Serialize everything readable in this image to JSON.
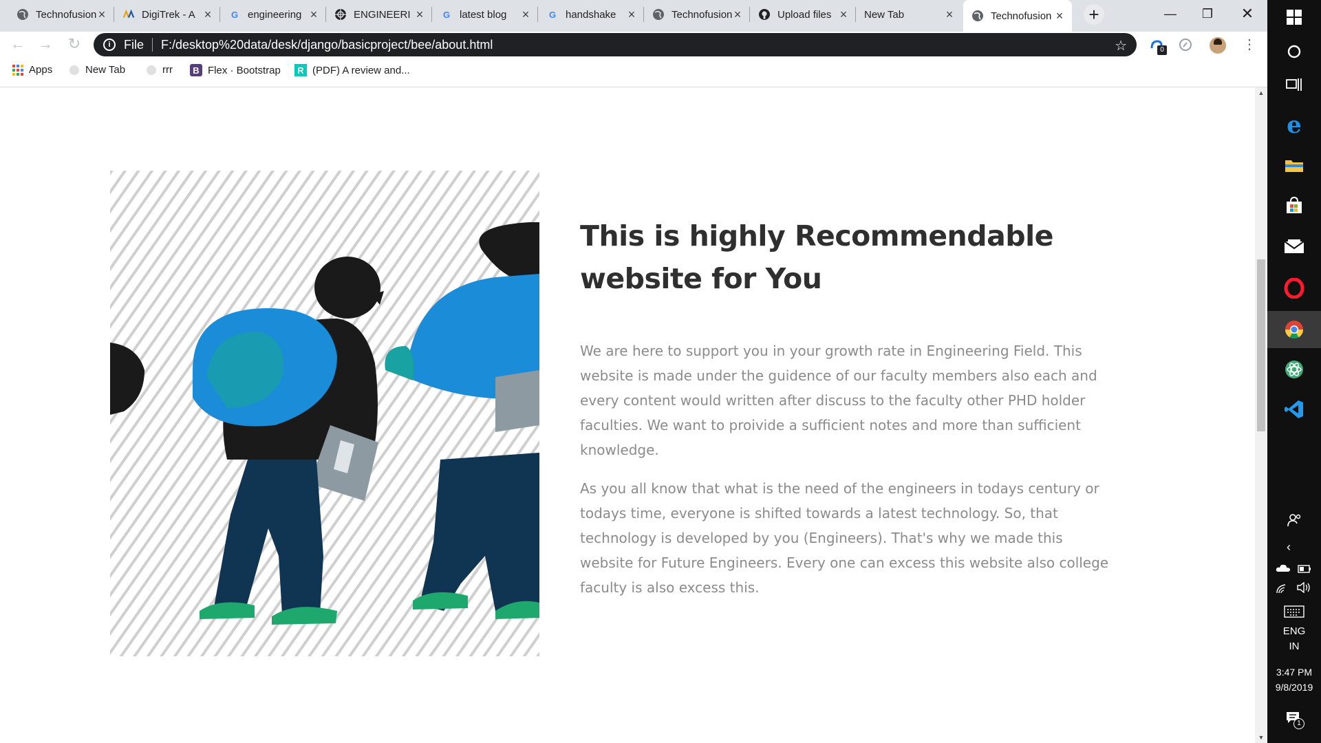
{
  "browser": {
    "tabs": [
      {
        "label": "Technofusion",
        "favicon": "globe-icon"
      },
      {
        "label": "DigiTrek - A",
        "favicon": "digitrek-icon"
      },
      {
        "label": "engineering",
        "favicon": "google-icon"
      },
      {
        "label": "ENGINEERI",
        "favicon": "engineering-site-icon"
      },
      {
        "label": "latest blog",
        "favicon": "google-icon"
      },
      {
        "label": "handshake",
        "favicon": "google-icon"
      },
      {
        "label": "Technofusion",
        "favicon": "globe-icon"
      },
      {
        "label": "Upload files",
        "favicon": "github-icon"
      },
      {
        "label": "New Tab",
        "favicon": ""
      },
      {
        "label": "Technofusion",
        "favicon": "globe-icon",
        "active": true
      }
    ],
    "address": {
      "scheme": "File",
      "url": "F:/desktop%20data/desk/django/basicproject/bee/about.html"
    },
    "extension_badge": "0",
    "bookmarks": [
      {
        "label": "Apps",
        "icon": "apps-grid-icon"
      },
      {
        "label": "New Tab",
        "icon": "globe-icon"
      },
      {
        "label": "rrr",
        "icon": "globe-icon"
      },
      {
        "label": "Flex · Bootstrap",
        "icon": "bootstrap-icon",
        "icon_text": "B"
      },
      {
        "label": "(PDF) A review and...",
        "icon": "researchgate-icon",
        "icon_text": "R"
      }
    ]
  },
  "content": {
    "heading": "This is highly Recommendable website for You",
    "paragraphs": [
      "We are here to support you in your growth rate in Engineering Field. This website is made under the guidence of our faculty members also each and every content would written after discuss to the faculty other PHD holder faculties. We want to proivide a sufficient notes and more than sufficient knowledge.",
      "As you all know that what is the need of the engineers in todays century or todays time, everyone is shifted towards a latest technology. So, that technology is developed by you (Engineers). That's why we made this website for Future Engineers. Every one can excess this website also college faculty is also excess this."
    ]
  },
  "taskbar": {
    "language": "ENG",
    "region": "IN",
    "time": "3:47 PM",
    "date": "9/8/2019",
    "notification_count": "1"
  }
}
